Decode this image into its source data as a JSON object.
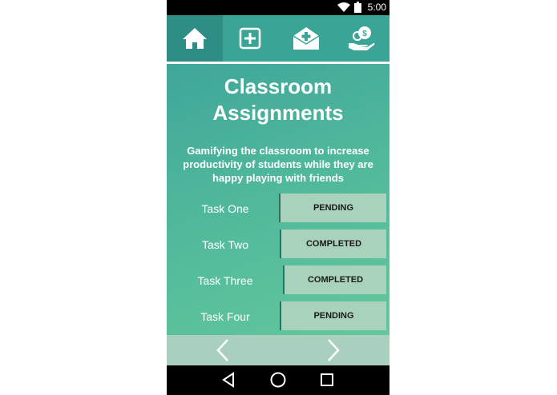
{
  "status_bar": {
    "time": "5:00"
  },
  "nav": {
    "items": [
      {
        "icon": "home-icon"
      },
      {
        "icon": "add-box-icon"
      },
      {
        "icon": "mail-add-icon"
      },
      {
        "icon": "hand-coins-icon"
      }
    ],
    "colors": {
      "bar": "#3aa597",
      "active": "#2e8e85"
    }
  },
  "main": {
    "title_line1": "Classroom",
    "title_line2": "Assignments",
    "subtitle": "Gamifying the classroom to increase productivity of students while they are happy playing with friends",
    "tasks": [
      {
        "name": "Task One",
        "status": "PENDING"
      },
      {
        "name": "Task Two",
        "status": "COMPLETED"
      },
      {
        "name": "Task Three",
        "status": "COMPLETED"
      },
      {
        "name": "Task Four",
        "status": "PENDING"
      }
    ]
  },
  "pager": {
    "prev_icon": "chevron-left-icon",
    "next_icon": "chevron-right-icon"
  },
  "system_nav": {
    "back_icon": "back-triangle-icon",
    "home_icon": "home-circle-icon",
    "recents_icon": "recents-square-icon"
  }
}
